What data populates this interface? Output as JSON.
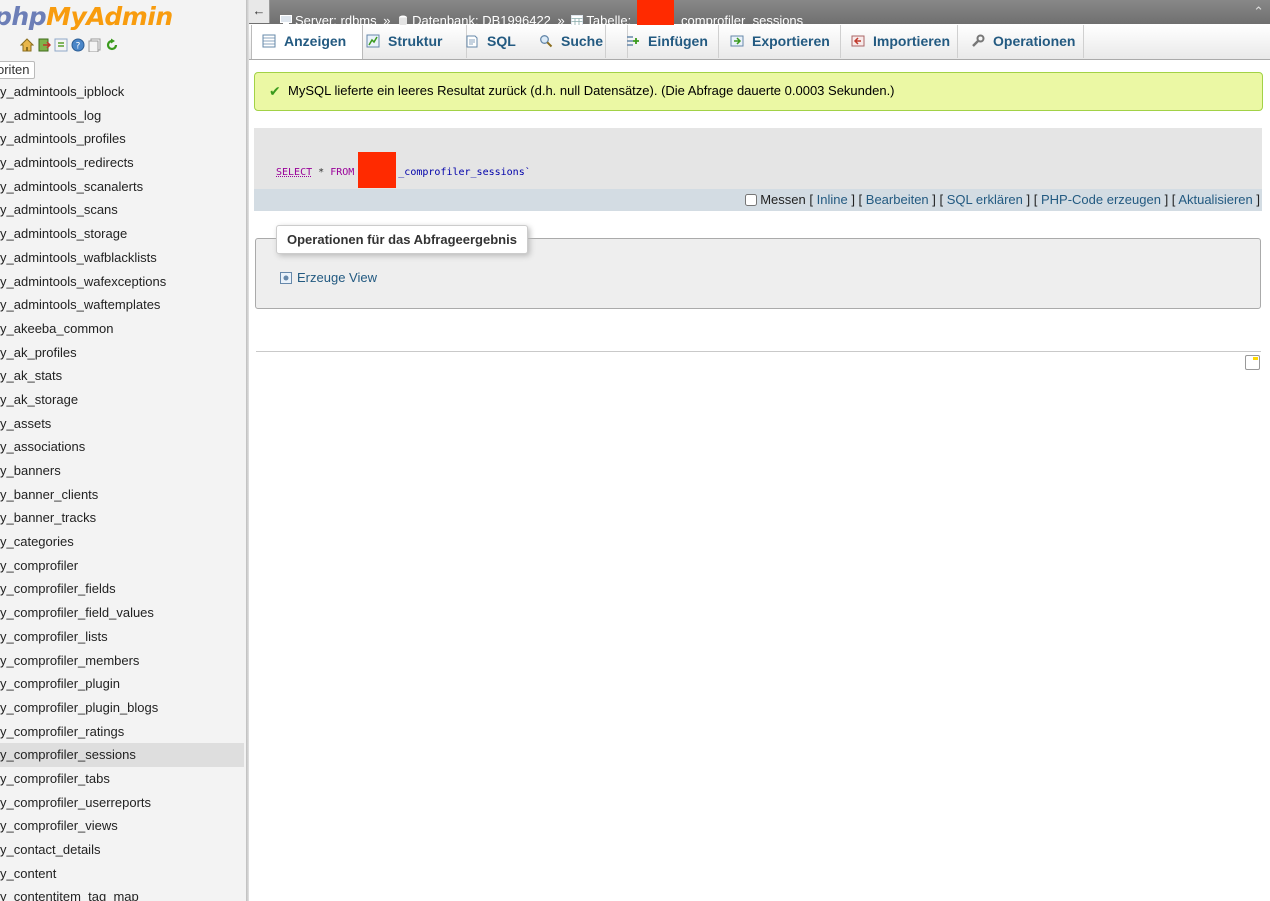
{
  "app": {
    "logo": {
      "php": "php",
      "my": "My",
      "admin": "Admin"
    }
  },
  "nav": {
    "favorites_label": "oriten",
    "icons": [
      "home-icon",
      "logout-icon",
      "query-window-icon",
      "help-icon",
      "docs-icon",
      "reload-icon"
    ],
    "tables": [
      "y_admintools_ipblock",
      "y_admintools_log",
      "y_admintools_profiles",
      "y_admintools_redirects",
      "y_admintools_scanalerts",
      "y_admintools_scans",
      "y_admintools_storage",
      "y_admintools_wafblacklists",
      "y_admintools_wafexceptions",
      "y_admintools_waftemplates",
      "y_akeeba_common",
      "y_ak_profiles",
      "y_ak_stats",
      "y_ak_storage",
      "y_assets",
      "y_associations",
      "y_banners",
      "y_banner_clients",
      "y_banner_tracks",
      "y_categories",
      "y_comprofiler",
      "y_comprofiler_fields",
      "y_comprofiler_field_values",
      "y_comprofiler_lists",
      "y_comprofiler_members",
      "y_comprofiler_plugin",
      "y_comprofiler_plugin_blogs",
      "y_comprofiler_ratings",
      "y_comprofiler_sessions",
      "y_comprofiler_tabs",
      "y_comprofiler_userreports",
      "y_comprofiler_views",
      "y_contact_details",
      "y_content",
      "y_contentitem_tag_map"
    ],
    "active_table": "y_comprofiler_sessions"
  },
  "topbar": {
    "back": "←",
    "server": "Server: rdbms",
    "sep": "»",
    "database": "Datenbank: DB1996422",
    "table_label": "Tabelle:",
    "table_suffix": "_comprofiler_sessions",
    "collapse": "⌃"
  },
  "tabs": [
    {
      "label": "Anzeigen",
      "icon": "browse-icon",
      "active": true
    },
    {
      "label": "Struktur",
      "icon": "structure-icon"
    },
    {
      "label": "SQL",
      "icon": "sql-icon"
    },
    {
      "label": "Suche",
      "icon": "search-icon"
    },
    {
      "label": "Einfügen",
      "icon": "insert-icon"
    },
    {
      "label": "Exportieren",
      "icon": "export-icon"
    },
    {
      "label": "Importieren",
      "icon": "import-icon"
    },
    {
      "label": "Operationen",
      "icon": "wrench-icon"
    }
  ],
  "result": {
    "message": "MySQL lieferte ein leeres Resultat zurück (d.h. null Datensätze). (Die Abfrage dauerte 0.0003 Sekunden.)"
  },
  "sql": {
    "select": "SELECT",
    "star": " * ",
    "from": "FROM",
    "table_suffix": "_comprofiler_sessions`"
  },
  "sql_actions": {
    "measure": "Messen",
    "inline": "Inline",
    "edit": "Bearbeiten",
    "explain": "SQL erklären",
    "php": "PHP-Code erzeugen",
    "refresh": "Aktualisieren",
    "lb": "[",
    "rb": "]",
    "mid": "] ["
  },
  "query_ops": {
    "legend": "Operationen für das Abfrageergebnis",
    "create_view": "Erzeuge View"
  },
  "colors": {
    "link": "#235a81",
    "success_bg": "#ebf8a4",
    "success_border": "#a2d246",
    "redaction": "#ff2a00"
  }
}
